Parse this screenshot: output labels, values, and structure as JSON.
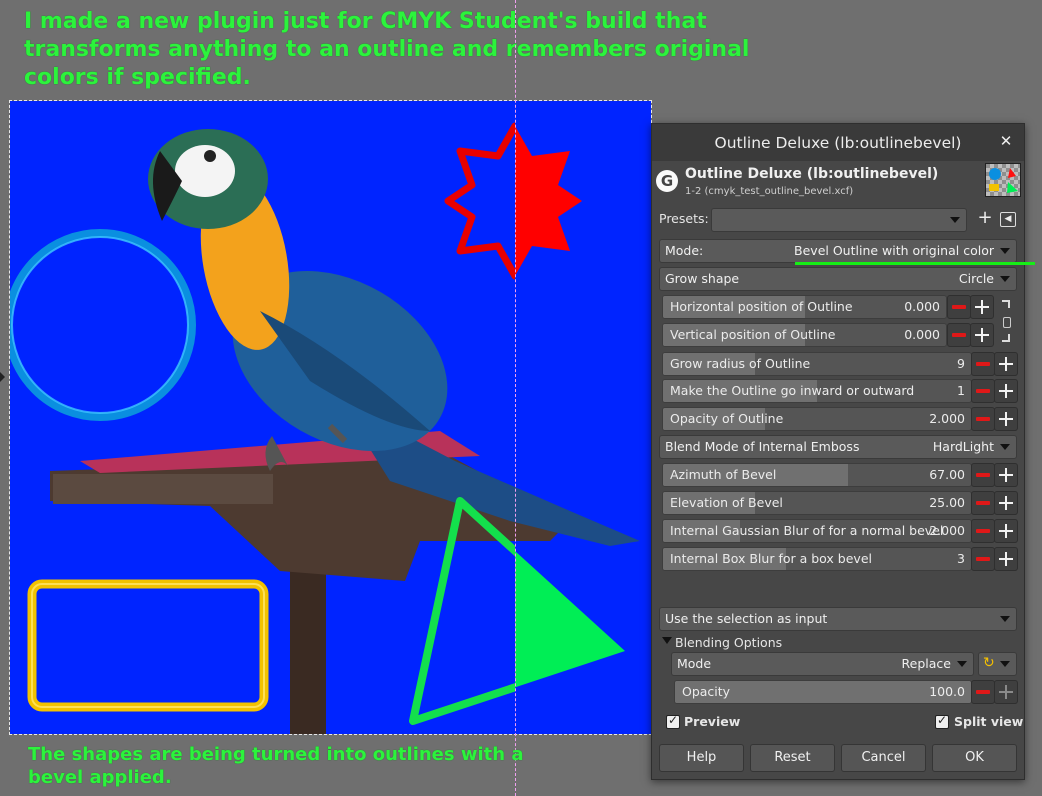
{
  "annotations": {
    "top": "I made a new plugin just for CMYK Student's build that transforms anything to an outline and remembers original colors if specified.",
    "bottom": "The shapes are being turned into outlines with a bevel applied."
  },
  "colors": {
    "canvas_bg": "#0024ff",
    "annotation_text": "#2cf33c",
    "ring": "#0a8fe0",
    "star": "#ff0000",
    "triangle": "#00ee55",
    "rect": "#f2c200"
  },
  "dialog": {
    "title": "Outline Deluxe (lb:outlinebevel)",
    "plugin_name": "Outline Deluxe (lb:outlinebevel)",
    "plugin_sub": "1-2 (cmyk_test_outline_bevel.xcf)",
    "presets_label": "Presets:",
    "presets_value": "",
    "mode_label": "Mode:",
    "mode_value": "Bevel Outline with original color",
    "grow_shape_label": "Grow shape",
    "grow_shape_value": "Circle",
    "sliders": [
      {
        "label": "Horizontal position of Outline",
        "value": "0.000",
        "fraction": 0.5
      },
      {
        "label": "Vertical position of Outline",
        "value": "0.000",
        "fraction": 0.5
      },
      {
        "label": "Grow radius of Outline",
        "value": "9",
        "fraction": 0.3
      },
      {
        "label": "Make the Outline go inward or outward",
        "value": "1",
        "fraction": 0.5
      },
      {
        "label": "Opacity of Outline",
        "value": "2.000",
        "fraction": 0.33
      }
    ],
    "blend_label": "Blend Mode of Internal Emboss",
    "blend_value": "HardLight",
    "sliders2": [
      {
        "label": "Azimuth of Bevel",
        "value": "67.00",
        "fraction": 0.6
      },
      {
        "label": "Elevation of Bevel",
        "value": "25.00",
        "fraction": 0.3
      },
      {
        "label": "Internal Gaussian Blur of for a normal bevel",
        "value": "2.000",
        "fraction": 0.25
      },
      {
        "label": "Internal Box Blur for a box bevel",
        "value": "3",
        "fraction": 0.4
      }
    ],
    "selection_combo": "Use the selection as input",
    "blending_options": "Blending Options",
    "bl_mode_label": "Mode",
    "bl_mode_value": "Replace",
    "bl_opacity_label": "Opacity",
    "bl_opacity_value": "100.0",
    "preview_label": "Preview",
    "split_label": "Split view",
    "buttons": {
      "help": "Help",
      "reset": "Reset",
      "cancel": "Cancel",
      "ok": "OK"
    }
  }
}
